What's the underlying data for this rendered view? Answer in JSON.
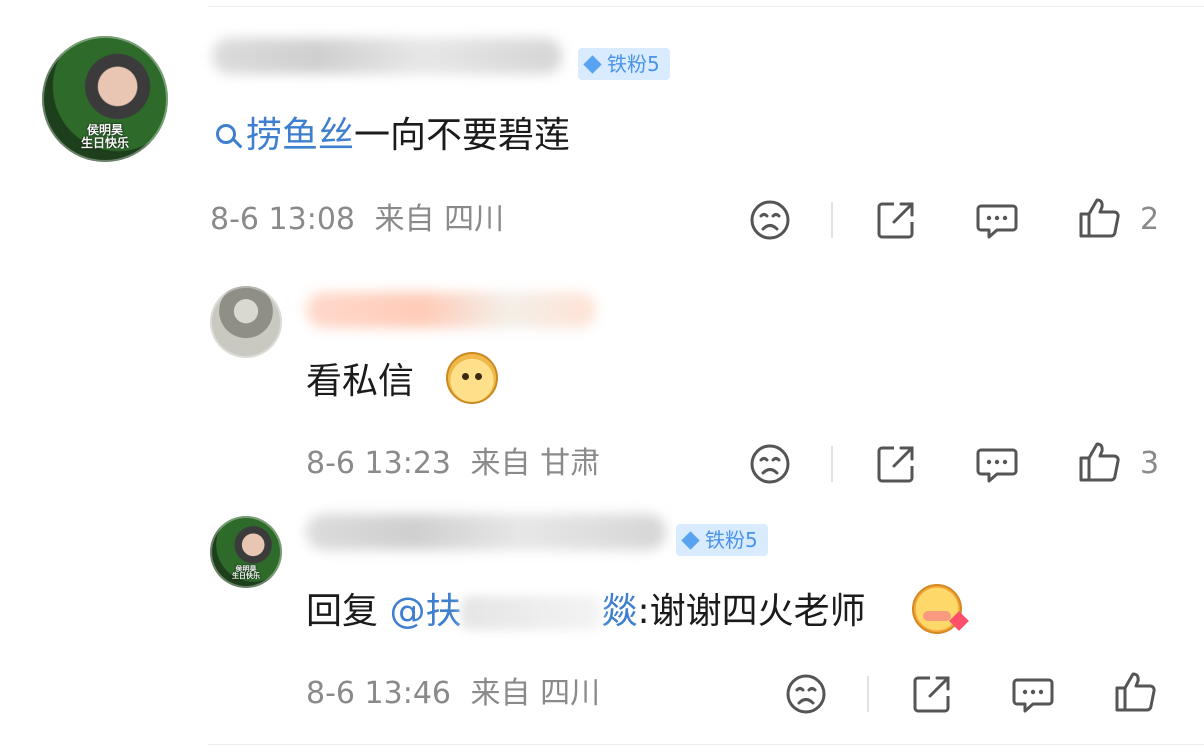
{
  "comments": [
    {
      "badge": "铁粉5",
      "hashtag": "捞鱼丝",
      "text": "一向不要碧莲",
      "avatar_caption": [
        "侯明昊",
        "生日快乐"
      ],
      "time": "8-6 13:08",
      "location": "来自 四川",
      "likes": "2"
    },
    {
      "text": "看私信",
      "emoji": "doge-emoji",
      "time": "8-6 13:23",
      "location": "来自 甘肃",
      "likes": "3"
    },
    {
      "badge": "铁粉5",
      "reply_prefix": "回复",
      "mention_at": "@",
      "mention_visible": "扶",
      "mention_end": "燚",
      "text": ":谢谢四火老师",
      "emoji": "shy-emoji",
      "avatar_caption": [
        "侯明昊",
        "生日快乐"
      ],
      "time": "8-6 13:46",
      "location": "来自 四川",
      "likes": ""
    }
  ],
  "icons": [
    "sad-face-icon",
    "share-icon",
    "comment-icon",
    "thumbs-up-icon"
  ],
  "colors": {
    "link": "#3e7fcf",
    "meta": "#8a8a8a",
    "badge_bg": "#d9ecff",
    "badge_text": "#4b93e9"
  }
}
